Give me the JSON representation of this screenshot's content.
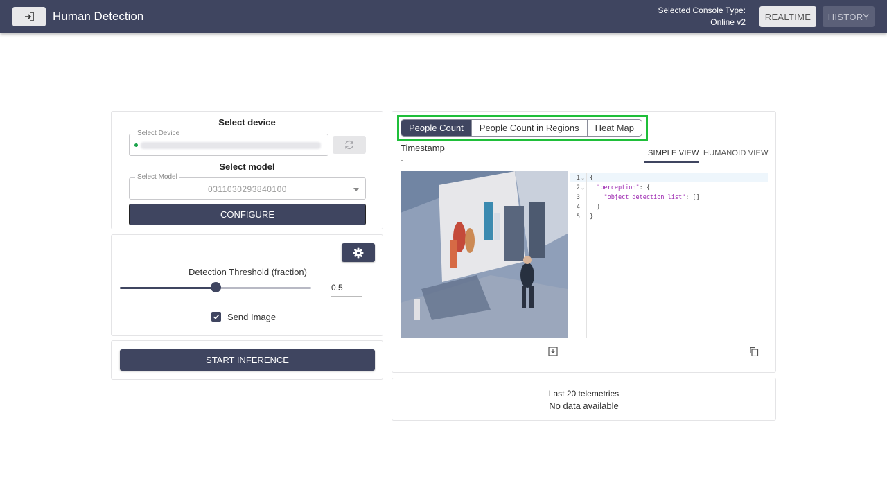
{
  "header": {
    "title": "Human Detection",
    "console_type_label": "Selected Console Type:",
    "console_type_value": "Online v2",
    "realtime_label": "REALTIME",
    "history_label": "HISTORY"
  },
  "device_section": {
    "title": "Select device",
    "device_legend": "Select Device",
    "status_color": "#1aa34a"
  },
  "model_section": {
    "title": "Select model",
    "model_legend": "Select Model",
    "model_value": "0311030293840100",
    "configure_label": "CONFIGURE"
  },
  "settings": {
    "threshold_label": "Detection Threshold (fraction)",
    "threshold_value": "0.5",
    "threshold_fraction": 0.5,
    "send_image_label": "Send Image",
    "send_image_checked": true
  },
  "actions": {
    "start_label": "START INFERENCE"
  },
  "result": {
    "tabs": [
      "People Count",
      "People Count in Regions",
      "Heat Map"
    ],
    "active_tab": 0,
    "timestamp_label": "Timestamp",
    "timestamp_value": "-",
    "view_tabs": [
      "SIMPLE VIEW",
      "HUMANOID VIEW"
    ],
    "json_lines": [
      "{",
      "  \"perception\": {",
      "    \"object_detection_list\": []",
      "  }",
      "}"
    ]
  },
  "telemetry": {
    "title": "Last 20 telemetries",
    "empty": "No data available"
  },
  "colors": {
    "primary": "#3f4560",
    "highlight": "#1fbf3a"
  }
}
